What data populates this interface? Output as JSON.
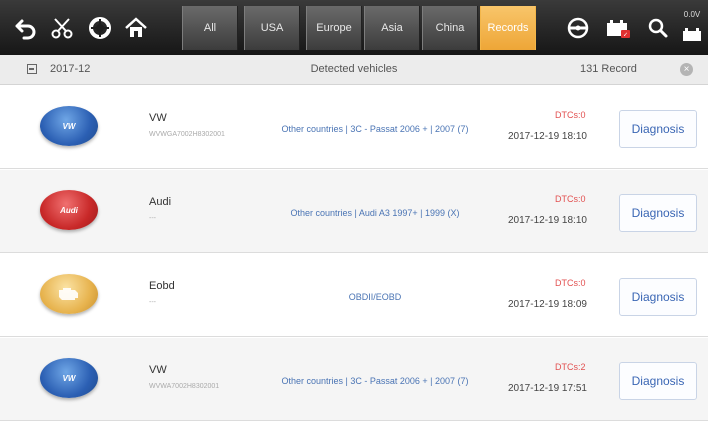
{
  "toolbar": {
    "icons": [
      "back-arrow-icon",
      "scissors-icon",
      "lifebuoy-icon",
      "home-icon",
      "steering-wheel-icon",
      "car-battery-icon",
      "search-icon",
      "voltage-icon"
    ],
    "tabs": [
      {
        "label": "All",
        "active": false
      },
      {
        "label": "USA",
        "active": false
      },
      {
        "label": "Europe",
        "active": false
      },
      {
        "label": "Asia",
        "active": false
      },
      {
        "label": "China",
        "active": false
      },
      {
        "label": "Records",
        "active": true
      }
    ],
    "voltage": "0.0V",
    "accent_color": "#f0aa3c"
  },
  "subheader": {
    "date": "2017-12",
    "title": "Detected vehicles",
    "count": "131 Record"
  },
  "records": [
    {
      "logo_text": "VW",
      "brand": "VW",
      "vin": "WVWGA7002H8302001",
      "description": "Other countries | 3C - Passat 2006 + | 2007 (7)",
      "dtc": "DTCs:0",
      "time": "2017-12-19 18:10",
      "action": "Diagnosis"
    },
    {
      "logo_text": "Audi",
      "brand": "Audi",
      "vin": "---",
      "description": "Other countries | Audi A3 1997+ | 1999 (X)",
      "dtc": "DTCs:0",
      "time": "2017-12-19 18:10",
      "action": "Diagnosis"
    },
    {
      "logo_text": "",
      "brand": "Eobd",
      "vin": "---",
      "description": "OBDII/EOBD",
      "dtc": "DTCs:0",
      "time": "2017-12-19 18:09",
      "action": "Diagnosis"
    },
    {
      "logo_text": "VW",
      "brand": "VW",
      "vin": "WVWA7002H8302001",
      "description": "Other countries | 3C - Passat 2006 + | 2007 (7)",
      "dtc": "DTCs:2",
      "time": "2017-12-19 17:51",
      "action": "Diagnosis"
    }
  ]
}
